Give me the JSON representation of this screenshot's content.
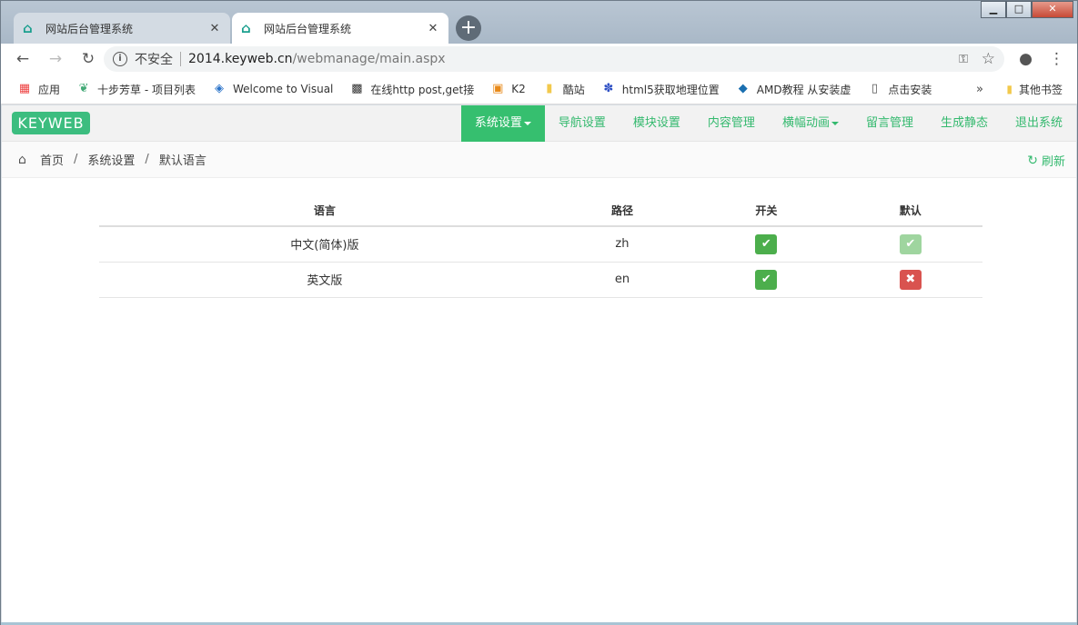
{
  "browser": {
    "tabs": [
      {
        "title": "网站后台管理系统",
        "active": false
      },
      {
        "title": "网站后台管理系统",
        "active": true
      }
    ],
    "new_tab": "+",
    "window_controls": {
      "minimize": "▁",
      "maximize": "□",
      "close": "✕"
    },
    "address": {
      "security": "不安全",
      "host": "2014.keyweb.cn",
      "path": "/webmanage/main.aspx"
    },
    "bookmarks": [
      {
        "label": "应用",
        "icon": "apps-grid-icon"
      },
      {
        "label": "十步芳草 - 项目列表",
        "icon": "leaf-icon"
      },
      {
        "label": "Welcome to Visual",
        "icon": "visual-studio-icon"
      },
      {
        "label": "在线http post,get接",
        "icon": "qr-icon"
      },
      {
        "label": "K2",
        "icon": "k2-icon"
      },
      {
        "label": "酷站",
        "icon": "folder-icon"
      },
      {
        "label": "html5获取地理位置",
        "icon": "paw-icon"
      },
      {
        "label": "AMD教程 从安装虚",
        "icon": "amd-icon"
      },
      {
        "label": "点击安装",
        "icon": "page-icon"
      }
    ],
    "bookmarks_more": "»",
    "other_bookmarks": "其他书签"
  },
  "app": {
    "logo": "KEYWEB",
    "menu": [
      {
        "label": "系统设置",
        "active": true,
        "dropdown": true
      },
      {
        "label": "导航设置",
        "active": false,
        "dropdown": false
      },
      {
        "label": "模块设置",
        "active": false,
        "dropdown": false
      },
      {
        "label": "内容管理",
        "active": false,
        "dropdown": false
      },
      {
        "label": "横幅动画",
        "active": false,
        "dropdown": true
      },
      {
        "label": "留言管理",
        "active": false,
        "dropdown": false
      },
      {
        "label": "生成静态",
        "active": false,
        "dropdown": false
      },
      {
        "label": "退出系统",
        "active": false,
        "dropdown": false
      }
    ],
    "breadcrumb": [
      "首页",
      "系统设置",
      "默认语言"
    ],
    "refresh": "刷新",
    "accent_color": "#36bf6f"
  },
  "table": {
    "headers": [
      "语言",
      "路径",
      "开关",
      "默认"
    ],
    "rows": [
      {
        "language": "中文(简体)版",
        "path": "zh",
        "enabled": true,
        "default": true
      },
      {
        "language": "英文版",
        "path": "en",
        "enabled": true,
        "default": false
      }
    ]
  }
}
